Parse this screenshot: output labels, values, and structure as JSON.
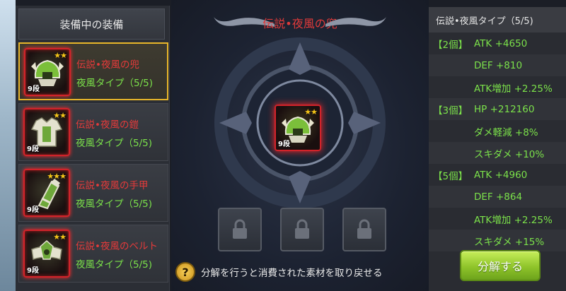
{
  "left_panel": {
    "title": "装備中の装備",
    "items": [
      {
        "name": "伝説•夜風の兜",
        "type": "夜風タイプ（5/5)",
        "rank": "9段",
        "stars": "★★"
      },
      {
        "name": "伝説•夜風の鎧",
        "type": "夜風タイプ（5/5)",
        "rank": "9段",
        "stars": "★★"
      },
      {
        "name": "伝説•夜風の手甲",
        "type": "夜風タイプ（5/5)",
        "rank": "9段",
        "stars": "★★★"
      },
      {
        "name": "伝説•夜風のベルト",
        "type": "夜風タイプ（5/5)",
        "rank": "9段",
        "stars": "★★"
      }
    ]
  },
  "center": {
    "title": "伝説•夜風の兜",
    "item_rank": "9段",
    "item_stars": "★★",
    "hint": "分解を行うと消費された素材を取り戻せる",
    "hint_icon": "?"
  },
  "right_panel": {
    "title": "伝説•夜風タイプ（5/5)",
    "bonuses": [
      {
        "count": "【2個】",
        "text": "ATK +4650"
      },
      {
        "count": "",
        "text": "DEF +810"
      },
      {
        "count": "",
        "text": "ATK増加 +2.25%"
      },
      {
        "count": "【3個】",
        "text": "HP +212160"
      },
      {
        "count": "",
        "text": "ダメ軽減 +8%"
      },
      {
        "count": "",
        "text": "スキダメ +10%"
      },
      {
        "count": "【5個】",
        "text": "ATK +4960"
      },
      {
        "count": "",
        "text": "DEF +864"
      },
      {
        "count": "",
        "text": "ATK増加 +2.25%"
      },
      {
        "count": "",
        "text": "スキダメ +15%"
      }
    ]
  },
  "decompose_button": "分解する",
  "colors": {
    "item_name": "#e63a3a",
    "set_text": "#7be14a",
    "selected_border": "#e8b62a",
    "button_green": "#8fc42a"
  }
}
